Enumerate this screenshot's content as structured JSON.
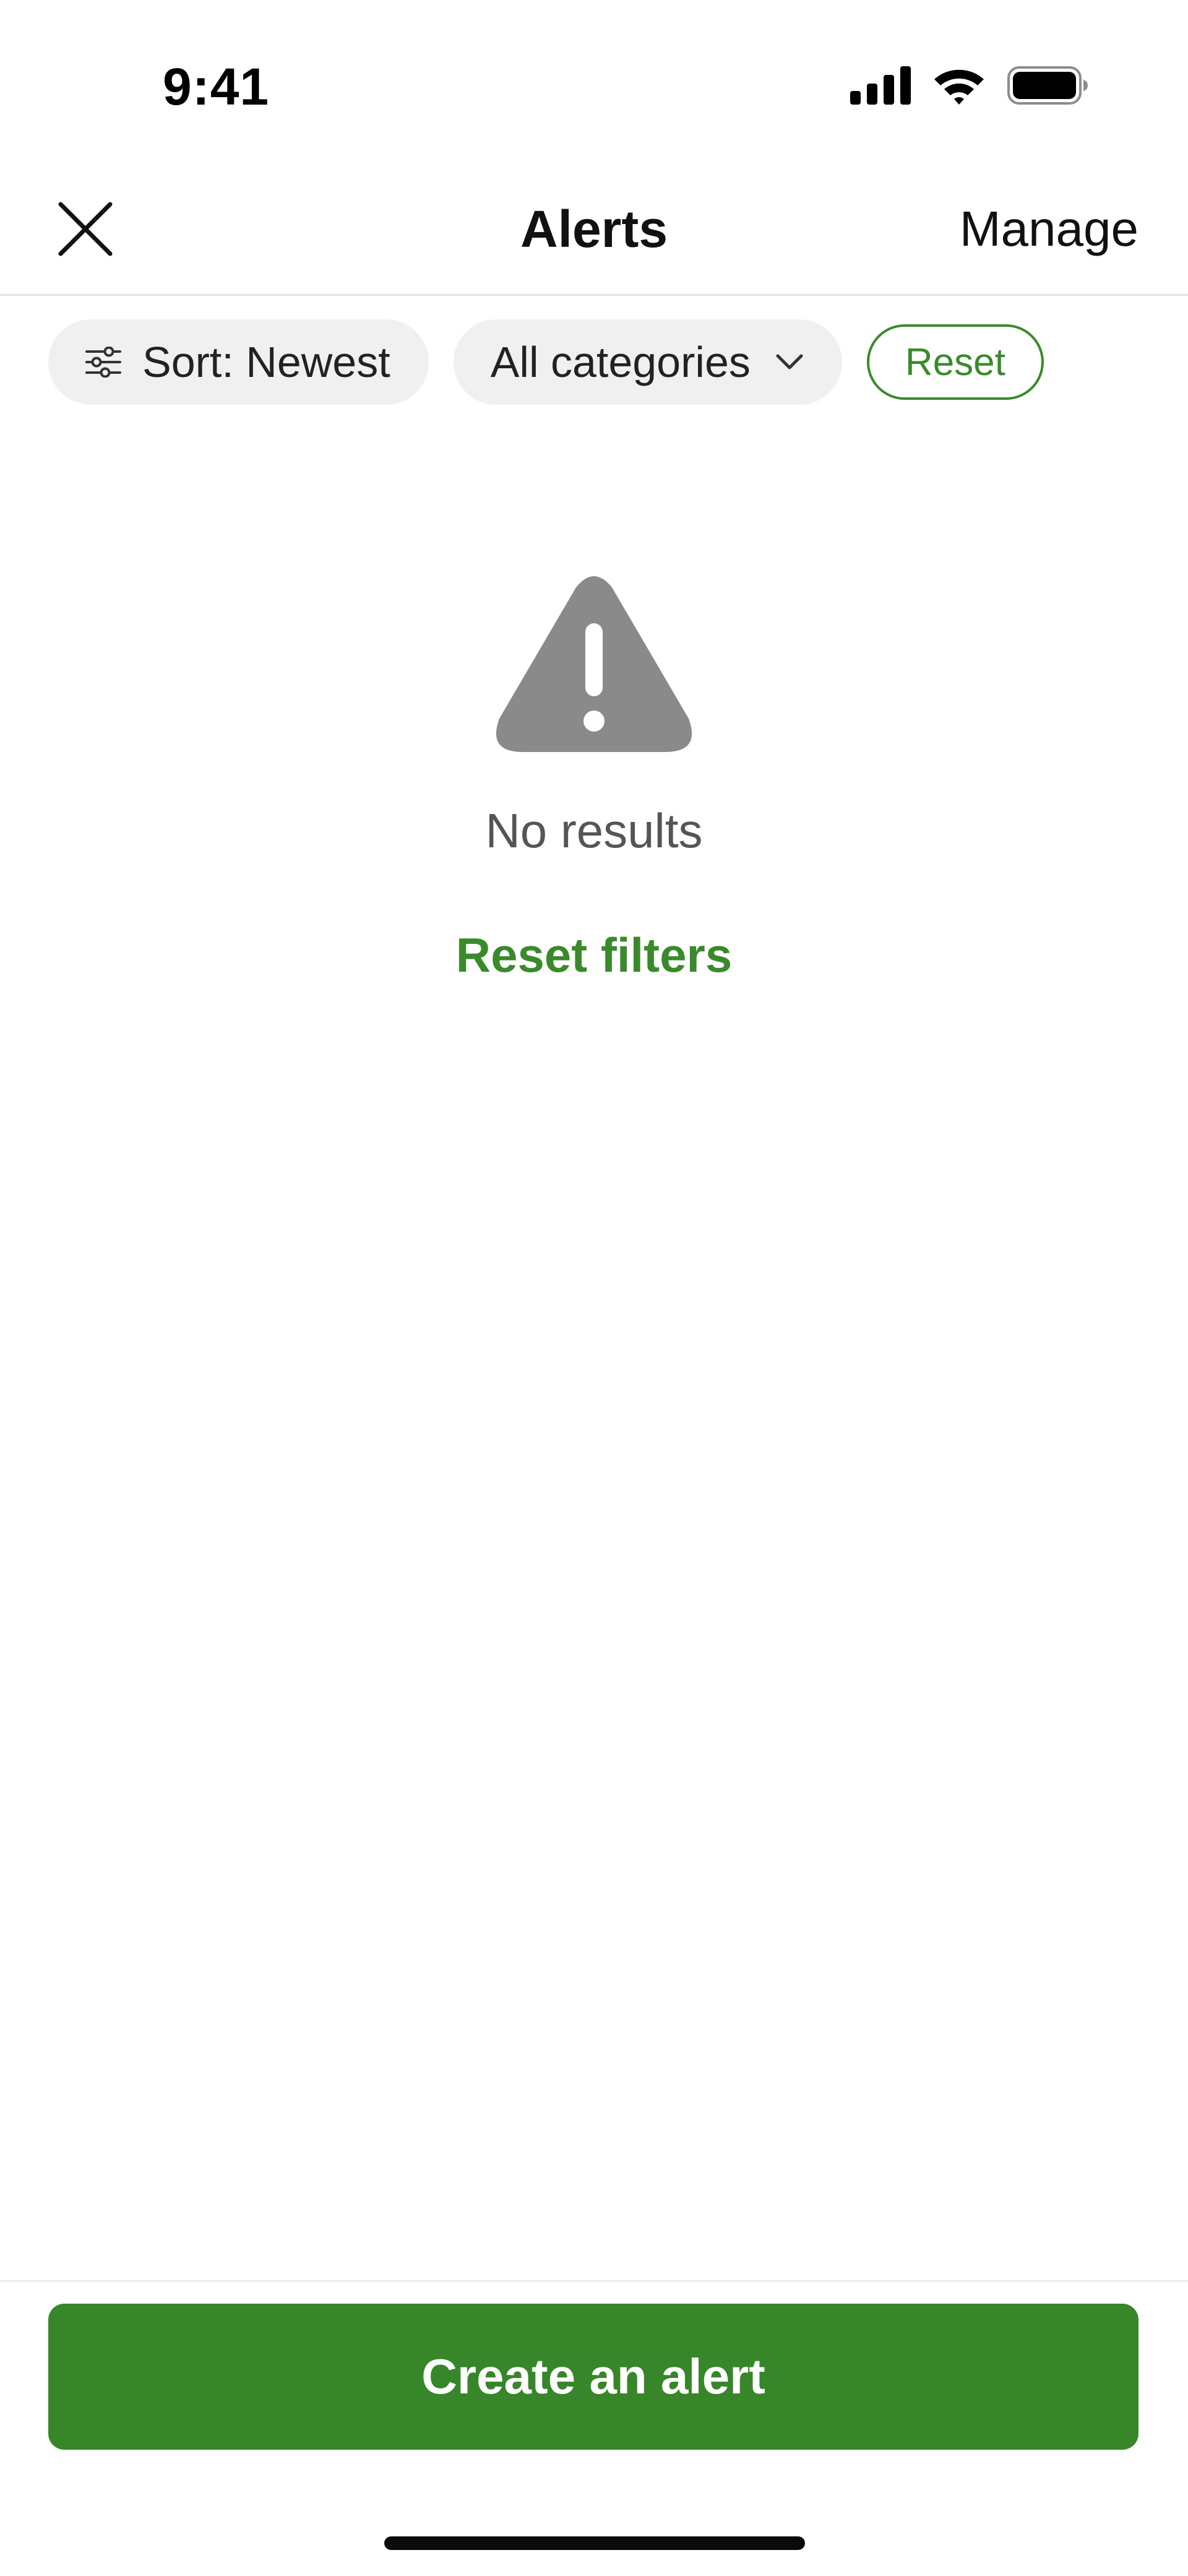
{
  "status_bar": {
    "time": "9:41",
    "icons": [
      "cellular-signal-icon",
      "wifi-icon",
      "battery-icon"
    ]
  },
  "nav": {
    "title": "Alerts",
    "manage_label": "Manage",
    "close_icon": "close-icon"
  },
  "filters": {
    "sort_label": "Sort: Newest",
    "sort_icon": "sliders-icon",
    "category_label": "All categories",
    "category_icon": "chevron-down-icon",
    "reset_label": "Reset"
  },
  "empty_state": {
    "icon": "warning-icon",
    "message": "No results",
    "reset_filters_label": "Reset filters"
  },
  "footer": {
    "create_alert_label": "Create an alert"
  },
  "colors": {
    "brand_green": "#37862a",
    "link_green": "#3a8a2b",
    "chip_background": "#f0f0f0",
    "icon_gray": "#8a8a8a"
  }
}
